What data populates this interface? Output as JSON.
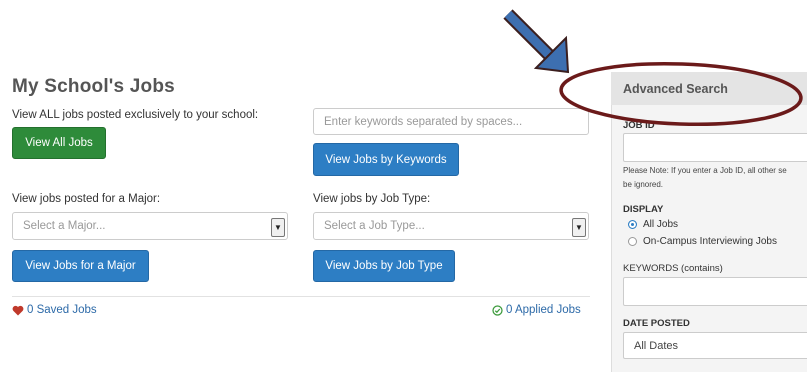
{
  "page": {
    "title": "My School's Jobs",
    "view_all_label": "View ALL jobs posted exclusively to your school:",
    "view_all_button": "View All Jobs",
    "keywords_placeholder": "Enter keywords separated by spaces...",
    "keywords_button": "View Jobs by Keywords",
    "major_label": "View jobs posted for a Major:",
    "major_select": "Select a Major...",
    "major_button": "View Jobs for a Major",
    "jobtype_label": "View jobs by Job Type:",
    "jobtype_select": "Select a Job Type...",
    "jobtype_button": "View Jobs by Job Type",
    "saved_jobs": "0 Saved Jobs",
    "applied_jobs": "0 Applied Jobs"
  },
  "advanced_search": {
    "title": "Advanced Search",
    "job_id_label": "JOB ID",
    "note_line1": "Please Note: If you enter a Job ID, all other se",
    "note_line2": "be ignored.",
    "display_label": "DISPLAY",
    "display_options": [
      "All Jobs",
      "On-Campus Interviewing Jobs"
    ],
    "keywords_label": "KEYWORDS (contains)",
    "date_posted_label": "DATE POSTED",
    "date_posted_value": "All Dates"
  },
  "colors": {
    "green_button": "#2e8b3a",
    "blue_button": "#2d7ec4",
    "annotation_circle": "#6b1a1a",
    "arrow": "#3d6fb0"
  },
  "icons": {
    "saved": "heart-icon",
    "applied": "check-circle-icon",
    "select": "chevron-down-icon"
  }
}
